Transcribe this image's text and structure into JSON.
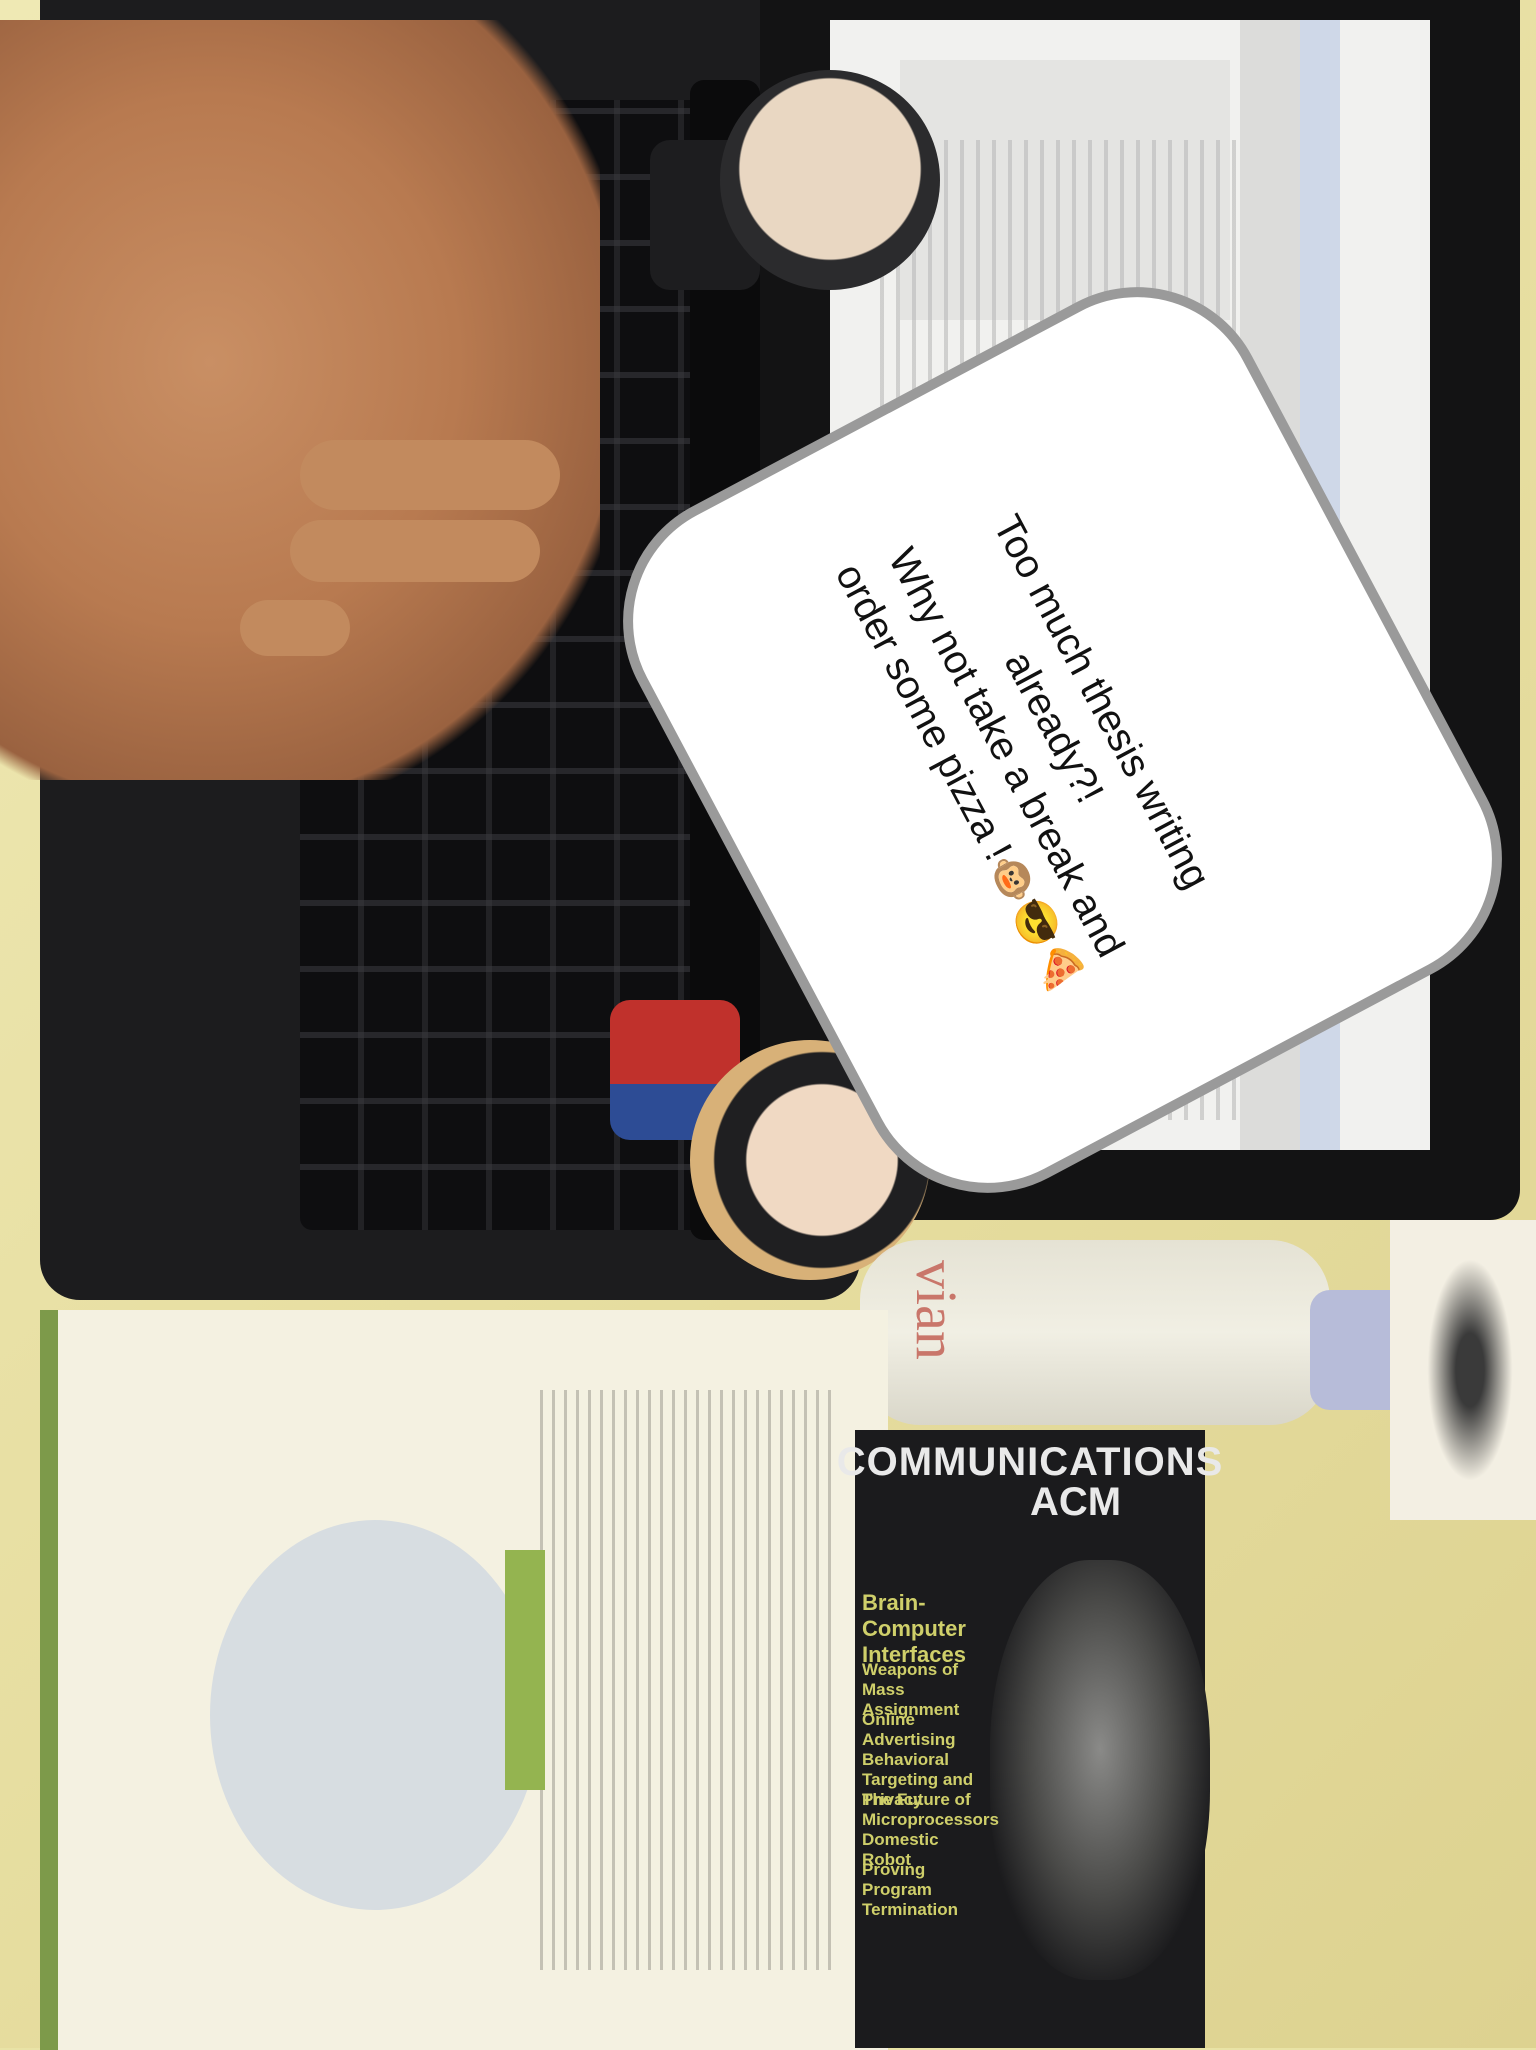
{
  "scene": {
    "description_labels": {
      "laptop": "laptop-with-document",
      "hand": "hand-on-keyboard",
      "figure_top": "chibi-figure-dark-hair",
      "figure_bottom": "chibi-figure-straw-hat",
      "bottle": "water-bottle",
      "book": "open-textbook",
      "magazine": "magazine-cover"
    }
  },
  "speech_bubble": {
    "line1": "Too much thesis writing",
    "line2": "already?!",
    "line3": "Why not take a break and",
    "line4": "order some pizza !🐵😎🍕"
  },
  "magazine": {
    "title": "COMMUNICATIONS",
    "subtitle": "ACM",
    "headline": "Brain-Computer Interfaces",
    "lines": [
      "Weapons of Mass Assignment",
      "Online Advertising Behavioral Targeting and Privacy",
      "The Future of Microprocessors",
      "Domestic Robot",
      "Proving Program Termination"
    ]
  },
  "bottle": {
    "brand": "vian"
  }
}
